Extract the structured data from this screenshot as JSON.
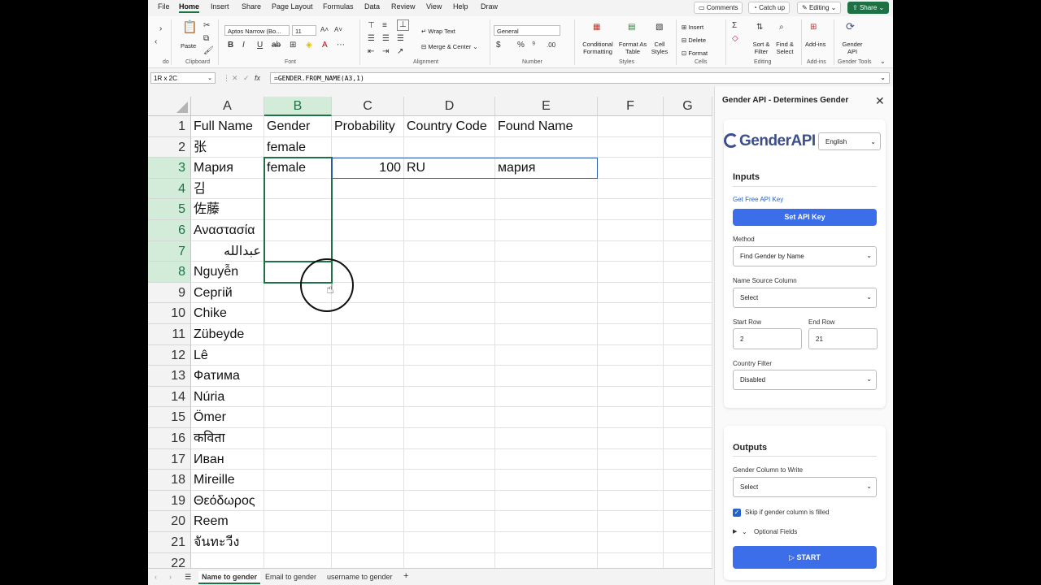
{
  "menu": {
    "items": [
      "File",
      "Home",
      "Insert",
      "Share",
      "Page Layout",
      "Formulas",
      "Data",
      "Review",
      "View",
      "Help",
      "Draw"
    ],
    "active": "Home",
    "comments": "Comments",
    "catch_up": "Catch up",
    "editing": "Editing",
    "share": "Share"
  },
  "ribbon": {
    "undo_label": "do",
    "clipboard": {
      "paste": "Paste",
      "label": "Clipboard"
    },
    "font": {
      "family": "Aptos Narrow (Bo...",
      "size": "11",
      "label": "Font"
    },
    "alignment": {
      "wrap": "Wrap Text",
      "merge": "Merge & Center",
      "label": "Alignment"
    },
    "number": {
      "format": "General",
      "label": "Number"
    },
    "styles": {
      "conditional": "Conditional Formatting",
      "format_as_table": "Format As Table",
      "cell_styles": "Cell Styles",
      "label": "Styles"
    },
    "cells": {
      "insert": "Insert",
      "delete": "Delete",
      "format": "Format",
      "label": "Cells"
    },
    "editing": {
      "sort": "Sort & Filter",
      "find": "Find & Select",
      "label": "Editing"
    },
    "addins": {
      "addins": "Add-ins",
      "label": "Add-ins"
    },
    "gender_tools": {
      "gender_api": "Gender API",
      "label": "Gender Tools"
    }
  },
  "formula_bar": {
    "name_box": "1R x 2C",
    "formula": "=GENDER.FROM_NAME(A3,1)"
  },
  "grid": {
    "columns": [
      "A",
      "B",
      "C",
      "D",
      "E",
      "F",
      "G"
    ],
    "rows": [
      [
        "Full Name",
        "Gender",
        "Probability",
        "Country Code",
        "Found Name"
      ],
      [
        "张",
        "female",
        "",
        "",
        ""
      ],
      [
        "Мария",
        "female",
        "100",
        "RU",
        "мария"
      ],
      [
        "김",
        "",
        "",
        "",
        ""
      ],
      [
        "佐藤",
        "",
        "",
        "",
        ""
      ],
      [
        "Αναστασία",
        "",
        "",
        "",
        ""
      ],
      [
        "عبدالله",
        "",
        "",
        "",
        ""
      ],
      [
        "Nguyễn",
        "",
        "",
        "",
        ""
      ],
      [
        "Сергій",
        "",
        "",
        "",
        ""
      ],
      [
        "Chike",
        "",
        "",
        "",
        ""
      ],
      [
        "Zübeyde",
        "",
        "",
        "",
        ""
      ],
      [
        "Lê",
        "",
        "",
        "",
        ""
      ],
      [
        "Фатима",
        "",
        "",
        "",
        ""
      ],
      [
        "Núria",
        "",
        "",
        "",
        ""
      ],
      [
        "Ömer",
        "",
        "",
        "",
        ""
      ],
      [
        "कविता",
        "",
        "",
        "",
        ""
      ],
      [
        "Иван",
        "",
        "",
        "",
        ""
      ],
      [
        "Mireille",
        "",
        "",
        "",
        ""
      ],
      [
        "Θεόδωρος",
        "",
        "",
        "",
        ""
      ],
      [
        "Reem",
        "",
        "",
        "",
        ""
      ],
      [
        "จันทะวีง",
        "",
        "",
        "",
        ""
      ],
      [
        "",
        "",
        "",
        "",
        ""
      ]
    ],
    "row_numbers": [
      "1",
      "2",
      "3",
      "4",
      "5",
      "6",
      "7",
      "8",
      "9",
      "10",
      "11",
      "12",
      "13",
      "14",
      "15",
      "16",
      "17",
      "18",
      "19",
      "20",
      "21",
      "22"
    ]
  },
  "sheets": {
    "tabs": [
      "Name to gender",
      "Email to gender",
      "username to gender"
    ],
    "active": "Name to gender",
    "add": "+"
  },
  "panel": {
    "title": "Gender API - Determines Gender",
    "logo": "GenderAPI",
    "language": "English",
    "inputs": {
      "title": "Inputs",
      "api_link": "Get Free API Key",
      "set_key": "Set API Key",
      "method_label": "Method",
      "method_value": "Find Gender by Name",
      "name_col_label": "Name Source Column",
      "name_col_value": "Select",
      "start_row_label": "Start Row",
      "start_row_value": "2",
      "end_row_label": "End Row",
      "end_row_value": "21",
      "country_label": "Country Filter",
      "country_value": "Disabled"
    },
    "outputs": {
      "title": "Outputs",
      "gender_col_label": "Gender Column to Write",
      "gender_col_value": "Select",
      "skip_label": "Skip if gender column is filled",
      "optional": "Optional Fields",
      "start": "START"
    }
  },
  "colors": {
    "excel_green": "#1e7145",
    "accent_blue": "#3d6ee9",
    "link_blue": "#2463c8"
  }
}
